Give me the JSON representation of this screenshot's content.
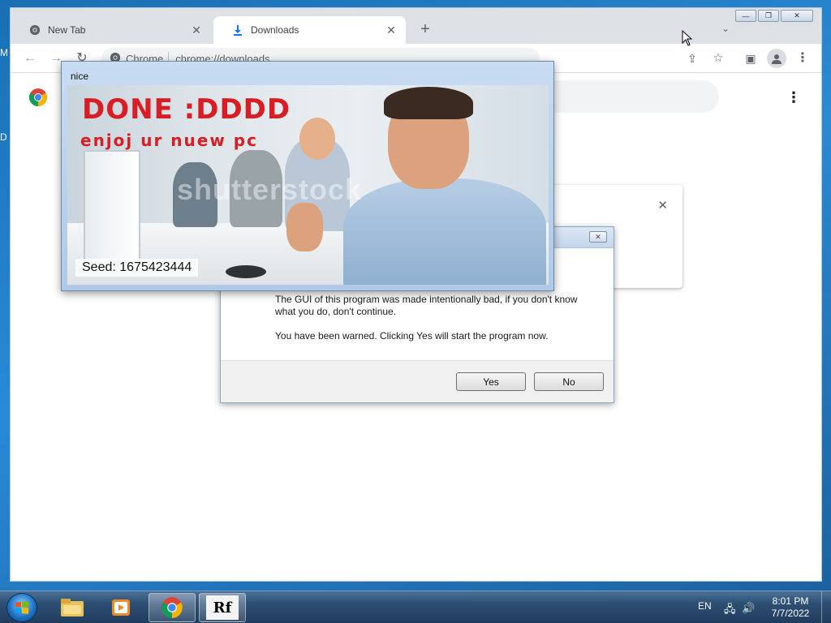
{
  "desktop": {
    "fragment_top": "M",
    "fragment_mid": "D"
  },
  "chrome": {
    "tabs": [
      {
        "title": "New Tab",
        "icon": "chrome-icon",
        "active": false
      },
      {
        "title": "Downloads",
        "icon": "download-icon",
        "active": true
      }
    ],
    "new_tab": "+",
    "tab_search": "⌄",
    "window_controls": {
      "minimize": "—",
      "restore": "❐",
      "close": "✕"
    },
    "omnibox": {
      "chip": "Chrome",
      "url": "chrome://downloads"
    },
    "downloads": {
      "card_close": "✕"
    },
    "menu_glyph": "⋮"
  },
  "nice_popup": {
    "title": "nice",
    "line1": "DONE :DDDD",
    "line2": "enjoj ur nuew pc",
    "watermark": "shutterstock",
    "seed": "Seed: 1675423444"
  },
  "warning_dialog": {
    "close": "✕",
    "message_1": "The GUI of this program was made intentionally bad, if you don't know what you do, don't continue.",
    "message_2": "You have been warned. Clicking Yes will start the program now.",
    "yes_label": "Yes",
    "no_label": "No"
  },
  "taskbar": {
    "language": "EN",
    "time": "8:01 PM",
    "date": "7/7/2022",
    "rf_label": "Rf"
  },
  "colors": {
    "warning_red": "#d81e24",
    "taskbar": "#2d4e72",
    "chrome_tabstrip": "#dee1e6"
  }
}
